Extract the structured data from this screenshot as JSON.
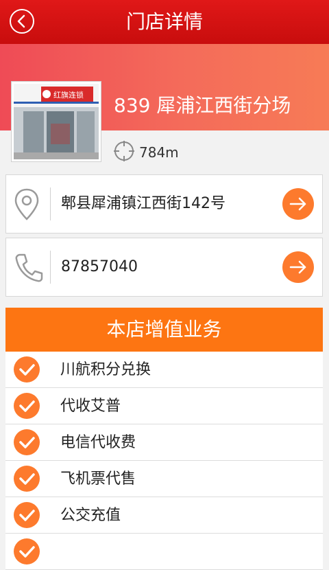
{
  "header": {
    "title": "门店详情"
  },
  "store": {
    "name": "839 犀浦江西街分场",
    "distance": "784m",
    "sign_text": "红旗连锁"
  },
  "address": {
    "text": "郫县犀浦镇江西街142号"
  },
  "phone": {
    "text": "87857040"
  },
  "services": {
    "title": "本店增值业务",
    "items": [
      {
        "label": "川航积分兑换"
      },
      {
        "label": "代收艾普"
      },
      {
        "label": "电信代收费"
      },
      {
        "label": "飞机票代售"
      },
      {
        "label": "公交充值"
      },
      {
        "label": ""
      }
    ]
  },
  "colors": {
    "topbar": "#d01010",
    "accent_orange": "#fd7a2d",
    "header_gradient_start": "#ef4b56",
    "header_gradient_end": "#f77b56"
  }
}
